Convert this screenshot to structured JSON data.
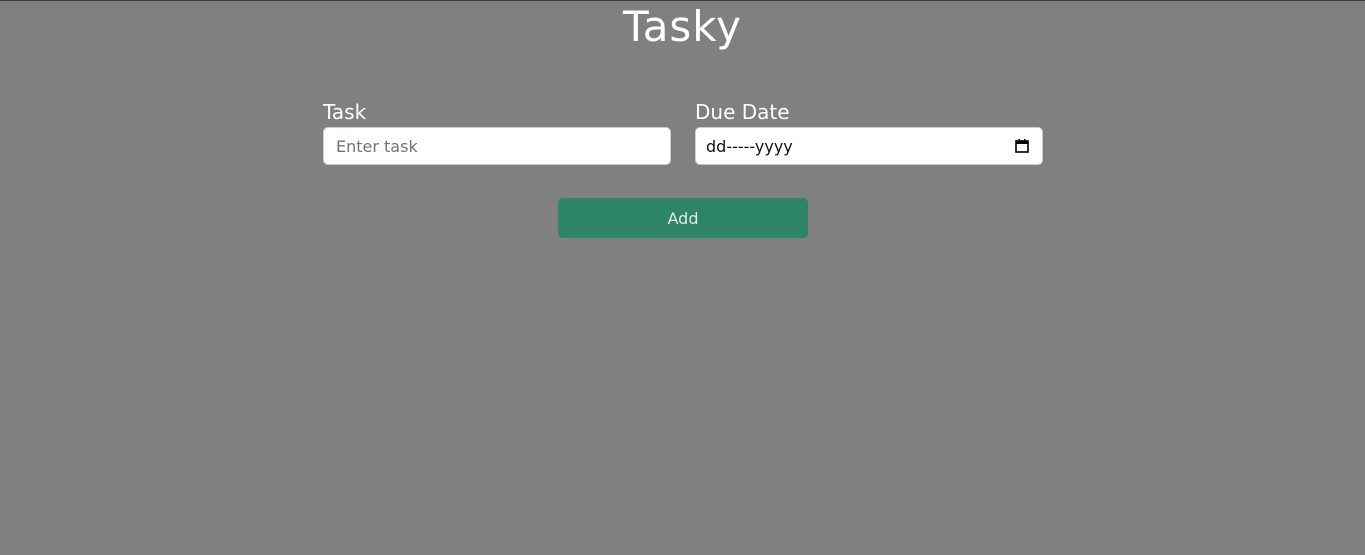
{
  "app": {
    "title": "Tasky"
  },
  "form": {
    "task_label": "Task",
    "task_placeholder": "Enter task",
    "task_value": "",
    "due_label": "Due Date",
    "due_value": "dd-----yyyy",
    "add_label": "Add"
  },
  "icons": {
    "date_picker": "calendar-icon"
  },
  "colors": {
    "background": "#808080",
    "button": "#2e8565",
    "title_text": "#ffffff"
  }
}
